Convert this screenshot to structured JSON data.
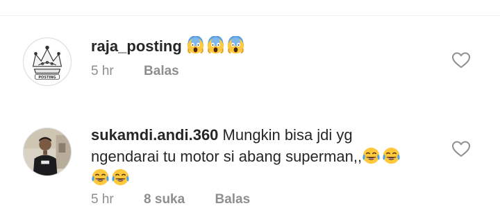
{
  "comments": [
    {
      "username": "raja_posting",
      "emojis": [
        "screaming-face",
        "screaming-face",
        "screaming-face"
      ],
      "time": "5 hr",
      "reply_label": "Balas",
      "avatar_text": "POSTING"
    },
    {
      "username": "sukamdi.andi.360",
      "text_line1": "Mungkin bisa jdi yg",
      "text_line2": "ngendarai tu motor si abang superman,,",
      "emojis_inline": [
        "tears-of-joy",
        "tears-of-joy"
      ],
      "emojis_line3": [
        "tears-of-joy",
        "tears-of-joy"
      ],
      "time": "5 hr",
      "likes": "8 suka",
      "reply_label": "Balas"
    }
  ],
  "colors": {
    "text": "#262626",
    "meta": "#8e8e8e",
    "emoji_yellow": "#ffc83d"
  },
  "icons": [
    "heart-icon",
    "screaming-face-emoji",
    "tears-of-joy-emoji"
  ]
}
